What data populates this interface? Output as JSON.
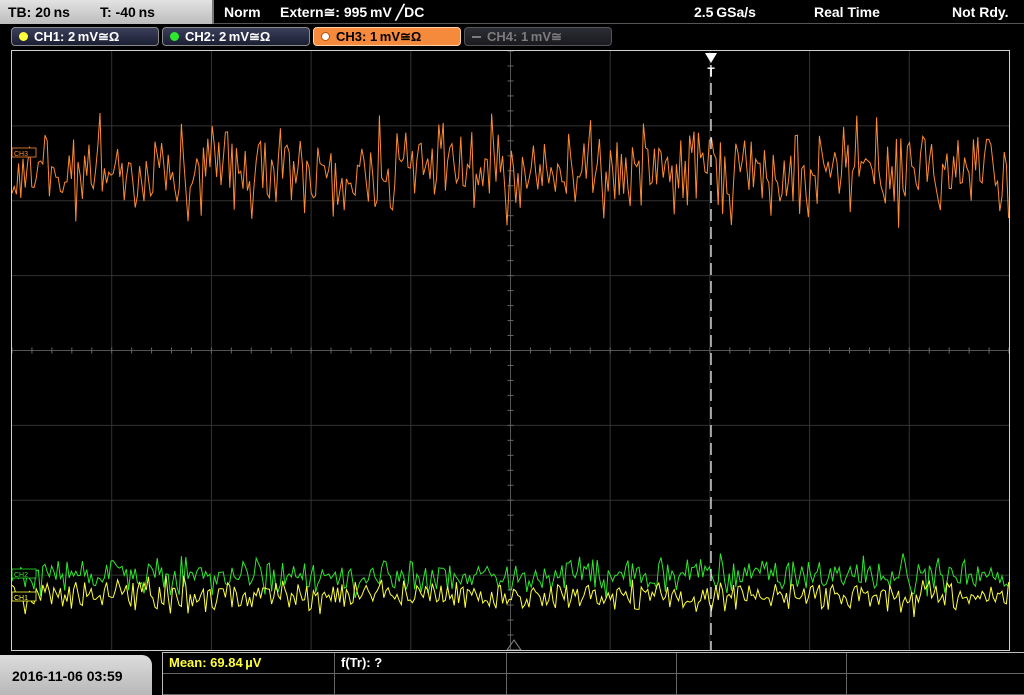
{
  "topbar": {
    "timebase": "TB: 20 ns",
    "trigger_offset": "T: -40 ns",
    "acq_mode": "Norm",
    "trigger_source": "Extern≅: 995 mV ╱DC",
    "sample_rate": "2.5 GSa/s",
    "run_mode": "Real Time",
    "status": "Not Rdy."
  },
  "channels": [
    {
      "label": "CH1: 2 mV≅Ω",
      "color": "#ffff3c",
      "state": "on"
    },
    {
      "label": "CH2: 2 mV≅Ω",
      "color": "#2ee62e",
      "state": "on"
    },
    {
      "label": "CH3: 1 mV≅Ω",
      "color": "#ff8a30",
      "state": "active"
    },
    {
      "label": "CH4: 1 mV≅",
      "color": "#7c7c7c",
      "state": "off"
    }
  ],
  "markers": {
    "ch3": "CH3",
    "ch2": "CH2",
    "ch1": "CH1",
    "trigger": "T"
  },
  "bottombar": {
    "datetime": "2016-11-06 03:59",
    "meas1": "Mean: 69.84 µV",
    "meas2": "f(Tr): ?"
  },
  "colors": {
    "ch1": "#ffff3c",
    "ch2": "#2ee62e",
    "ch3": "#ff8a30",
    "grid": "#3a3a3a"
  }
}
